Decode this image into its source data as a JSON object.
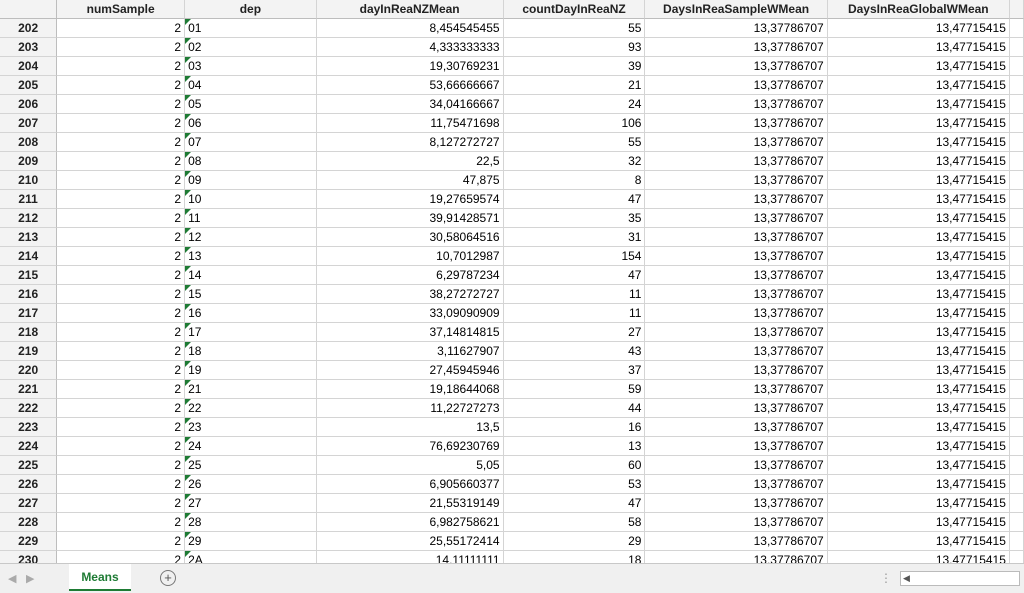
{
  "columns": [
    "numSample",
    "dep",
    "dayInReaNZMean",
    "countDayInReaNZ",
    "DaysInReaSampleWMean",
    "DaysInReaGlobalWMean"
  ],
  "rows": [
    {
      "n": "202",
      "numSample": "2",
      "dep": "01",
      "mean": "8,454545455",
      "count": "55",
      "sample": "13,37786707",
      "global": "13,47715415"
    },
    {
      "n": "203",
      "numSample": "2",
      "dep": "02",
      "mean": "4,333333333",
      "count": "93",
      "sample": "13,37786707",
      "global": "13,47715415"
    },
    {
      "n": "204",
      "numSample": "2",
      "dep": "03",
      "mean": "19,30769231",
      "count": "39",
      "sample": "13,37786707",
      "global": "13,47715415"
    },
    {
      "n": "205",
      "numSample": "2",
      "dep": "04",
      "mean": "53,66666667",
      "count": "21",
      "sample": "13,37786707",
      "global": "13,47715415"
    },
    {
      "n": "206",
      "numSample": "2",
      "dep": "05",
      "mean": "34,04166667",
      "count": "24",
      "sample": "13,37786707",
      "global": "13,47715415"
    },
    {
      "n": "207",
      "numSample": "2",
      "dep": "06",
      "mean": "11,75471698",
      "count": "106",
      "sample": "13,37786707",
      "global": "13,47715415"
    },
    {
      "n": "208",
      "numSample": "2",
      "dep": "07",
      "mean": "8,127272727",
      "count": "55",
      "sample": "13,37786707",
      "global": "13,47715415"
    },
    {
      "n": "209",
      "numSample": "2",
      "dep": "08",
      "mean": "22,5",
      "count": "32",
      "sample": "13,37786707",
      "global": "13,47715415"
    },
    {
      "n": "210",
      "numSample": "2",
      "dep": "09",
      "mean": "47,875",
      "count": "8",
      "sample": "13,37786707",
      "global": "13,47715415"
    },
    {
      "n": "211",
      "numSample": "2",
      "dep": "10",
      "mean": "19,27659574",
      "count": "47",
      "sample": "13,37786707",
      "global": "13,47715415"
    },
    {
      "n": "212",
      "numSample": "2",
      "dep": "11",
      "mean": "39,91428571",
      "count": "35",
      "sample": "13,37786707",
      "global": "13,47715415"
    },
    {
      "n": "213",
      "numSample": "2",
      "dep": "12",
      "mean": "30,58064516",
      "count": "31",
      "sample": "13,37786707",
      "global": "13,47715415"
    },
    {
      "n": "214",
      "numSample": "2",
      "dep": "13",
      "mean": "10,7012987",
      "count": "154",
      "sample": "13,37786707",
      "global": "13,47715415"
    },
    {
      "n": "215",
      "numSample": "2",
      "dep": "14",
      "mean": "6,29787234",
      "count": "47",
      "sample": "13,37786707",
      "global": "13,47715415"
    },
    {
      "n": "216",
      "numSample": "2",
      "dep": "15",
      "mean": "38,27272727",
      "count": "11",
      "sample": "13,37786707",
      "global": "13,47715415"
    },
    {
      "n": "217",
      "numSample": "2",
      "dep": "16",
      "mean": "33,09090909",
      "count": "11",
      "sample": "13,37786707",
      "global": "13,47715415"
    },
    {
      "n": "218",
      "numSample": "2",
      "dep": "17",
      "mean": "37,14814815",
      "count": "27",
      "sample": "13,37786707",
      "global": "13,47715415"
    },
    {
      "n": "219",
      "numSample": "2",
      "dep": "18",
      "mean": "3,11627907",
      "count": "43",
      "sample": "13,37786707",
      "global": "13,47715415"
    },
    {
      "n": "220",
      "numSample": "2",
      "dep": "19",
      "mean": "27,45945946",
      "count": "37",
      "sample": "13,37786707",
      "global": "13,47715415"
    },
    {
      "n": "221",
      "numSample": "2",
      "dep": "21",
      "mean": "19,18644068",
      "count": "59",
      "sample": "13,37786707",
      "global": "13,47715415"
    },
    {
      "n": "222",
      "numSample": "2",
      "dep": "22",
      "mean": "11,22727273",
      "count": "44",
      "sample": "13,37786707",
      "global": "13,47715415"
    },
    {
      "n": "223",
      "numSample": "2",
      "dep": "23",
      "mean": "13,5",
      "count": "16",
      "sample": "13,37786707",
      "global": "13,47715415"
    },
    {
      "n": "224",
      "numSample": "2",
      "dep": "24",
      "mean": "76,69230769",
      "count": "13",
      "sample": "13,37786707",
      "global": "13,47715415"
    },
    {
      "n": "225",
      "numSample": "2",
      "dep": "25",
      "mean": "5,05",
      "count": "60",
      "sample": "13,37786707",
      "global": "13,47715415"
    },
    {
      "n": "226",
      "numSample": "2",
      "dep": "26",
      "mean": "6,905660377",
      "count": "53",
      "sample": "13,37786707",
      "global": "13,47715415"
    },
    {
      "n": "227",
      "numSample": "2",
      "dep": "27",
      "mean": "21,55319149",
      "count": "47",
      "sample": "13,37786707",
      "global": "13,47715415"
    },
    {
      "n": "228",
      "numSample": "2",
      "dep": "28",
      "mean": "6,982758621",
      "count": "58",
      "sample": "13,37786707",
      "global": "13,47715415"
    },
    {
      "n": "229",
      "numSample": "2",
      "dep": "29",
      "mean": "25,55172414",
      "count": "29",
      "sample": "13,37786707",
      "global": "13,47715415"
    },
    {
      "n": "230",
      "numSample": "2",
      "dep": "2A",
      "mean": "14,11111111",
      "count": "18",
      "sample": "13,37786707",
      "global": "13,47715415"
    }
  ],
  "sheet_tab": "Means",
  "add_sheet_icon": "plus-circle-icon",
  "accent_color": "#1e7b34"
}
